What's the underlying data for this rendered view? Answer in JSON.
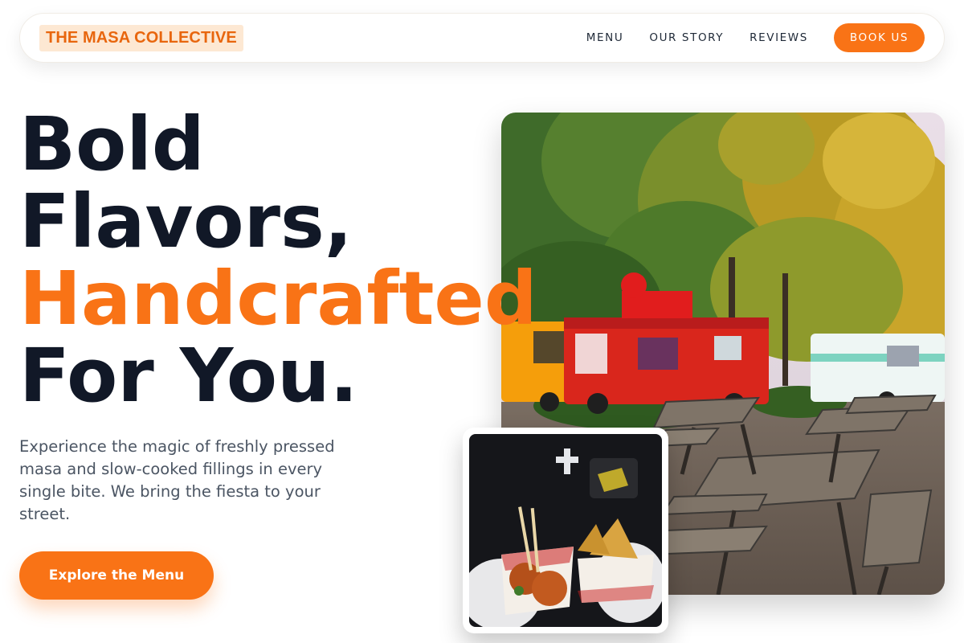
{
  "brand": {
    "name": "THE MASA COLLECTIVE"
  },
  "nav": {
    "links": [
      "MENU",
      "OUR STORY",
      "REVIEWS"
    ],
    "book_label": "BOOK US"
  },
  "hero": {
    "headline_line1": "Bold",
    "headline_line2": "Flavors,",
    "headline_accent": "Handcrafted",
    "headline_line4": "For You.",
    "description": "Experience the magic of freshly pressed masa and slow-cooked fillings in every single bite. We bring the fiesta to your street.",
    "cta_label": "Explore the Menu"
  },
  "colors": {
    "accent": "#f97316",
    "logo_bg": "#fde8d3",
    "heading": "#111827",
    "body_text": "#4b5563"
  }
}
